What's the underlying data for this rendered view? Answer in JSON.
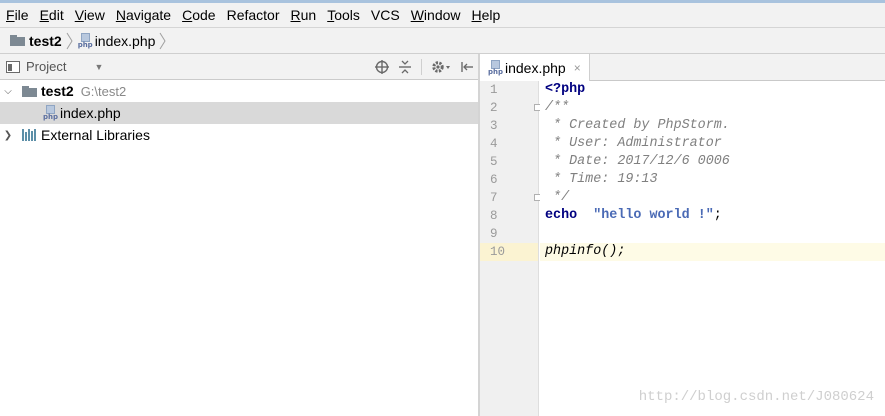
{
  "menu": [
    {
      "mnemonic": "F",
      "rest": "ile"
    },
    {
      "mnemonic": "E",
      "rest": "dit"
    },
    {
      "mnemonic": "V",
      "rest": "iew"
    },
    {
      "mnemonic": "N",
      "rest": "avigate"
    },
    {
      "mnemonic": "C",
      "rest": "ode"
    },
    {
      "mnemonic": "",
      "rest": "Refactor"
    },
    {
      "mnemonic": "R",
      "rest": "un"
    },
    {
      "mnemonic": "T",
      "rest": "ools"
    },
    {
      "mnemonic": "",
      "rest": "VCS"
    },
    {
      "mnemonic": "W",
      "rest": "indow"
    },
    {
      "mnemonic": "H",
      "rest": "elp"
    }
  ],
  "breadcrumb": {
    "project": "test2",
    "file": "index.php"
  },
  "project_panel": {
    "title": "Project",
    "tree": [
      {
        "label": "test2",
        "hint": "G:\\test2",
        "type": "folder",
        "expanded": true
      },
      {
        "label": "index.php",
        "type": "php-file",
        "selected": true
      },
      {
        "label": "External Libraries",
        "type": "libraries",
        "expanded": false
      }
    ]
  },
  "editor": {
    "tab_label": "index.php",
    "close_glyph": "×",
    "lines": [
      {
        "num": "1",
        "code": "<?php"
      },
      {
        "num": "2",
        "code": "/**"
      },
      {
        "num": "3",
        "code": " * Created by PhpStorm."
      },
      {
        "num": "4",
        "code": " * User: Administrator"
      },
      {
        "num": "5",
        "code": " * Date: 2017/12/6 0006"
      },
      {
        "num": "6",
        "code": " * Time: 19:13"
      },
      {
        "num": "7",
        "code": " */"
      },
      {
        "num": "8",
        "code": "echo  \"hello world !\";"
      },
      {
        "num": "9",
        "code": ""
      },
      {
        "num": "10",
        "code": "phpinfo();"
      }
    ]
  },
  "watermark": "http://blog.csdn.net/J080624",
  "colors": {
    "keyword": "#000080",
    "comment": "#808080",
    "string": "#4a6ab5",
    "current_line": "#fefbe6"
  }
}
